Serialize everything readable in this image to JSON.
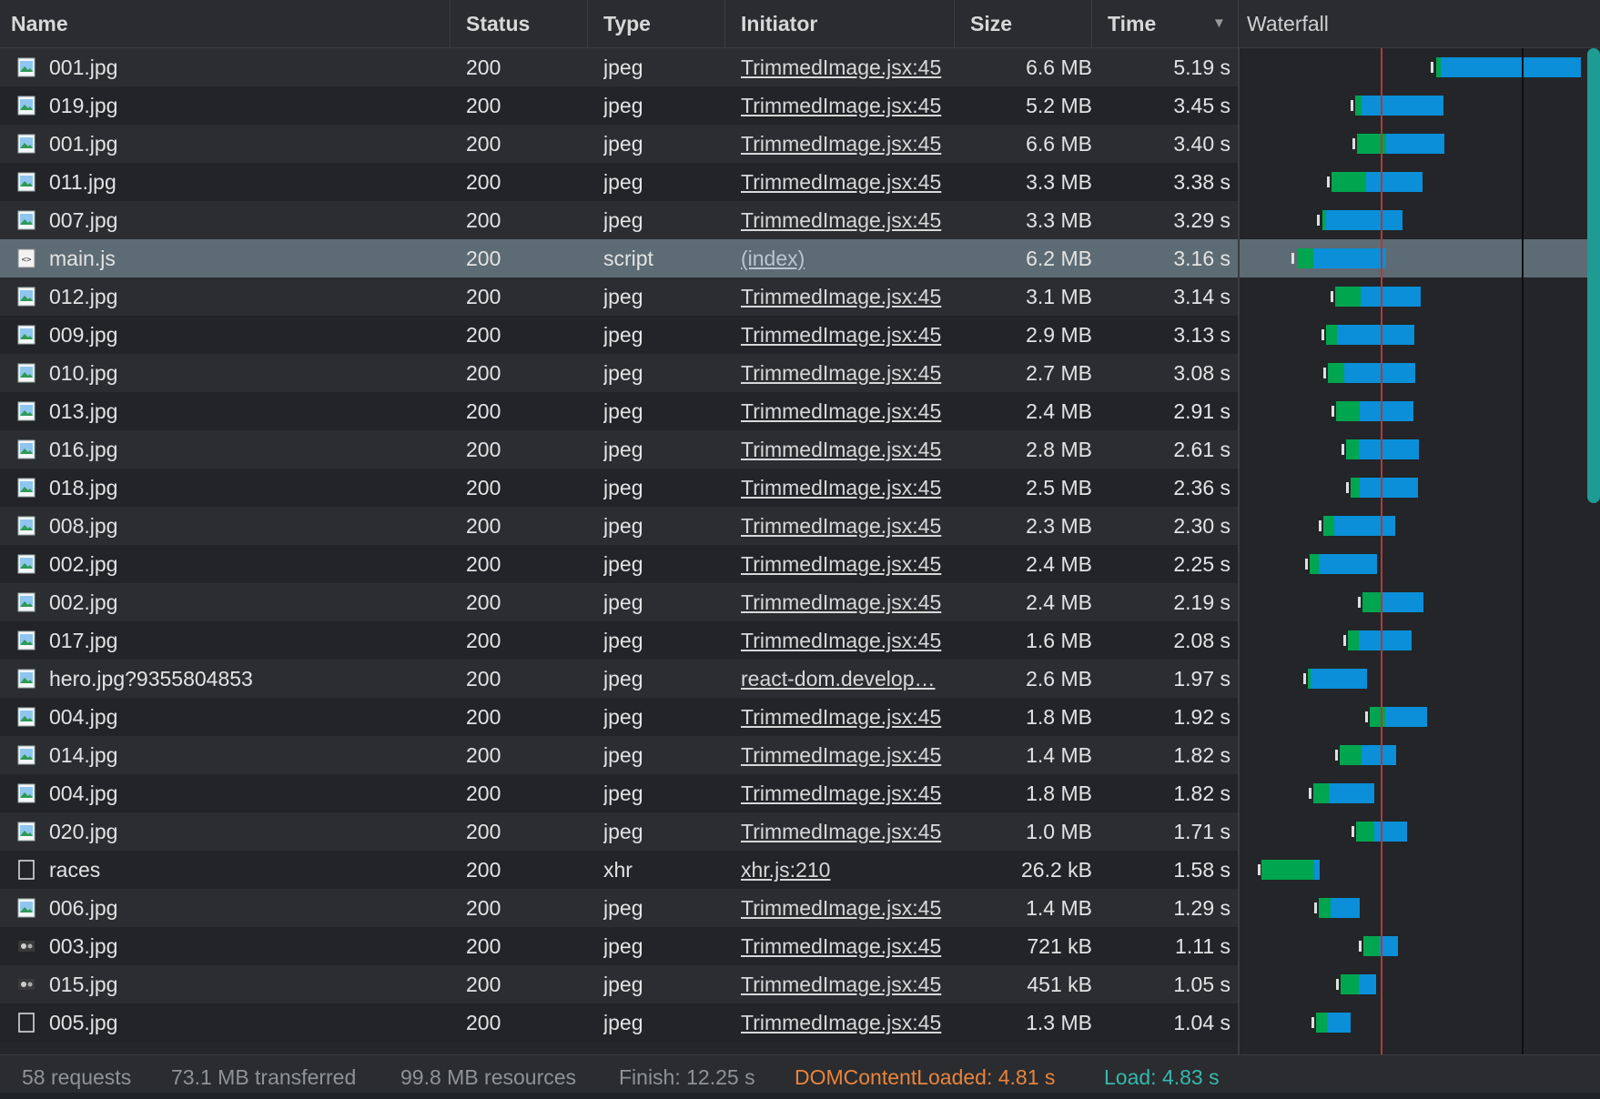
{
  "columns": {
    "name": "Name",
    "status": "Status",
    "type": "Type",
    "initiator": "Initiator",
    "size": "Size",
    "time": "Time",
    "waterfall": "Waterfall",
    "sort_icon": "sort-descending-icon"
  },
  "colors": {
    "selected_row": "#5d6b74",
    "waiting": "#00a54f",
    "download": "#0a8fd8",
    "dom_line": "#b03a3a",
    "load_line": "#0f0f10",
    "dcl_text": "#e8843f",
    "load_text": "#39b7ad"
  },
  "rows": [
    {
      "name": "001.jpg",
      "status": "200",
      "type": "jpeg",
      "initiator": "TrimmedImage.jsx:45",
      "size": "6.6 MB",
      "time": "5.19 s",
      "icon": "image-icon"
    },
    {
      "name": "019.jpg",
      "status": "200",
      "type": "jpeg",
      "initiator": "TrimmedImage.jsx:45",
      "size": "5.2 MB",
      "time": "3.45 s",
      "icon": "image-icon"
    },
    {
      "name": "001.jpg",
      "status": "200",
      "type": "jpeg",
      "initiator": "TrimmedImage.jsx:45",
      "size": "6.6 MB",
      "time": "3.40 s",
      "icon": "image-icon"
    },
    {
      "name": "011.jpg",
      "status": "200",
      "type": "jpeg",
      "initiator": "TrimmedImage.jsx:45",
      "size": "3.3 MB",
      "time": "3.38 s",
      "icon": "image-icon"
    },
    {
      "name": "007.jpg",
      "status": "200",
      "type": "jpeg",
      "initiator": "TrimmedImage.jsx:45",
      "size": "3.3 MB",
      "time": "3.29 s",
      "icon": "image-icon"
    },
    {
      "name": "main.js",
      "status": "200",
      "type": "script",
      "initiator": "(index)",
      "size": "6.2 MB",
      "time": "3.16 s",
      "icon": "script-icon",
      "selected": true
    },
    {
      "name": "012.jpg",
      "status": "200",
      "type": "jpeg",
      "initiator": "TrimmedImage.jsx:45",
      "size": "3.1 MB",
      "time": "3.14 s",
      "icon": "image-icon"
    },
    {
      "name": "009.jpg",
      "status": "200",
      "type": "jpeg",
      "initiator": "TrimmedImage.jsx:45",
      "size": "2.9 MB",
      "time": "3.13 s",
      "icon": "image-icon"
    },
    {
      "name": "010.jpg",
      "status": "200",
      "type": "jpeg",
      "initiator": "TrimmedImage.jsx:45",
      "size": "2.7 MB",
      "time": "3.08 s",
      "icon": "image-icon"
    },
    {
      "name": "013.jpg",
      "status": "200",
      "type": "jpeg",
      "initiator": "TrimmedImage.jsx:45",
      "size": "2.4 MB",
      "time": "2.91 s",
      "icon": "image-icon"
    },
    {
      "name": "016.jpg",
      "status": "200",
      "type": "jpeg",
      "initiator": "TrimmedImage.jsx:45",
      "size": "2.8 MB",
      "time": "2.61 s",
      "icon": "image-icon"
    },
    {
      "name": "018.jpg",
      "status": "200",
      "type": "jpeg",
      "initiator": "TrimmedImage.jsx:45",
      "size": "2.5 MB",
      "time": "2.36 s",
      "icon": "image-icon"
    },
    {
      "name": "008.jpg",
      "status": "200",
      "type": "jpeg",
      "initiator": "TrimmedImage.jsx:45",
      "size": "2.3 MB",
      "time": "2.30 s",
      "icon": "image-icon"
    },
    {
      "name": "002.jpg",
      "status": "200",
      "type": "jpeg",
      "initiator": "TrimmedImage.jsx:45",
      "size": "2.4 MB",
      "time": "2.25 s",
      "icon": "image-icon"
    },
    {
      "name": "002.jpg",
      "status": "200",
      "type": "jpeg",
      "initiator": "TrimmedImage.jsx:45",
      "size": "2.4 MB",
      "time": "2.19 s",
      "icon": "image-icon"
    },
    {
      "name": "017.jpg",
      "status": "200",
      "type": "jpeg",
      "initiator": "TrimmedImage.jsx:45",
      "size": "1.6 MB",
      "time": "2.08 s",
      "icon": "image-icon"
    },
    {
      "name": "hero.jpg?9355804853",
      "status": "200",
      "type": "jpeg",
      "initiator": "react-dom.develop…",
      "size": "2.6 MB",
      "time": "1.97 s",
      "icon": "image-icon"
    },
    {
      "name": "004.jpg",
      "status": "200",
      "type": "jpeg",
      "initiator": "TrimmedImage.jsx:45",
      "size": "1.8 MB",
      "time": "1.92 s",
      "icon": "image-icon"
    },
    {
      "name": "014.jpg",
      "status": "200",
      "type": "jpeg",
      "initiator": "TrimmedImage.jsx:45",
      "size": "1.4 MB",
      "time": "1.82 s",
      "icon": "image-icon"
    },
    {
      "name": "004.jpg",
      "status": "200",
      "type": "jpeg",
      "initiator": "TrimmedImage.jsx:45",
      "size": "1.8 MB",
      "time": "1.82 s",
      "icon": "image-icon"
    },
    {
      "name": "020.jpg",
      "status": "200",
      "type": "jpeg",
      "initiator": "TrimmedImage.jsx:45",
      "size": "1.0 MB",
      "time": "1.71 s",
      "icon": "image-icon"
    },
    {
      "name": "races",
      "status": "200",
      "type": "xhr",
      "initiator": "xhr.js:210",
      "size": "26.2 kB",
      "time": "1.58 s",
      "icon": "document-icon"
    },
    {
      "name": "006.jpg",
      "status": "200",
      "type": "jpeg",
      "initiator": "TrimmedImage.jsx:45",
      "size": "1.4 MB",
      "time": "1.29 s",
      "icon": "image-icon"
    },
    {
      "name": "003.jpg",
      "status": "200",
      "type": "jpeg",
      "initiator": "TrimmedImage.jsx:45",
      "size": "721 kB",
      "time": "1.11 s",
      "icon": "image-thumb-icon"
    },
    {
      "name": "015.jpg",
      "status": "200",
      "type": "jpeg",
      "initiator": "TrimmedImage.jsx:45",
      "size": "451 kB",
      "time": "1.05 s",
      "icon": "image-thumb-icon"
    },
    {
      "name": "005.jpg",
      "status": "200",
      "type": "jpeg",
      "initiator": "TrimmedImage.jsx:45",
      "size": "1.3 MB",
      "time": "1.04 s",
      "icon": "document-icon"
    }
  ],
  "footer": {
    "requests": "58 requests",
    "transferred": "73.1 MB transferred",
    "resources": "99.8 MB resources",
    "finish": "Finish: 12.25 s",
    "dom_content_loaded": "DOMContentLoaded: 4.81 s",
    "load": "Load: 4.83 s"
  }
}
